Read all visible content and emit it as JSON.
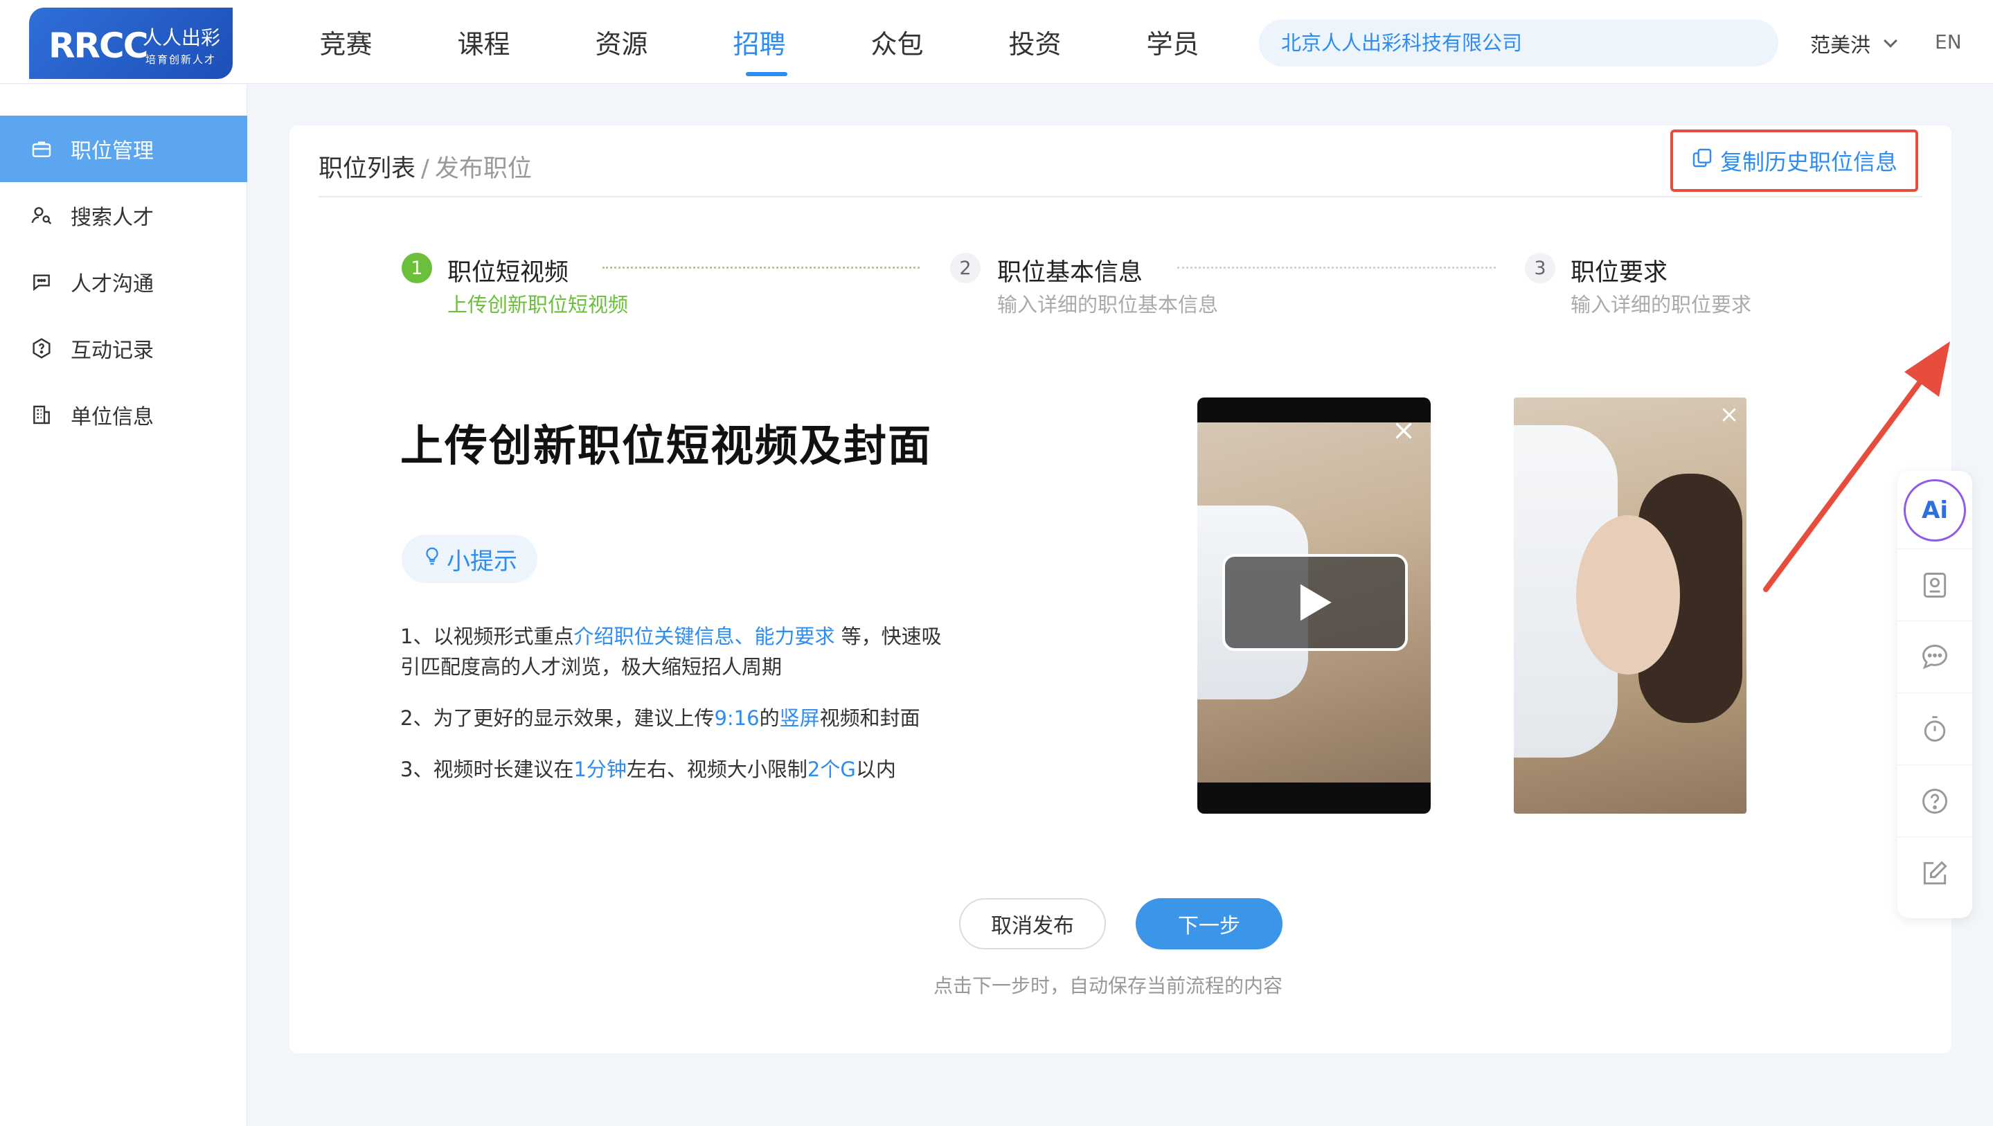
{
  "brand": {
    "logo_text": "RRCC",
    "logo_cn": "人人出彩",
    "logo_sub": "培育创新人才"
  },
  "nav": {
    "items": [
      {
        "label": "竞赛"
      },
      {
        "label": "课程"
      },
      {
        "label": "资源"
      },
      {
        "label": "招聘"
      },
      {
        "label": "众包"
      },
      {
        "label": "投资"
      },
      {
        "label": "学员"
      }
    ],
    "active": "招聘"
  },
  "header": {
    "company": "北京人人出彩科技有限公司",
    "user_name": "范美洪",
    "lang": "EN"
  },
  "sidebar": {
    "items": [
      {
        "label": "职位管理",
        "icon": "briefcase-icon"
      },
      {
        "label": "搜索人才",
        "icon": "person-search-icon"
      },
      {
        "label": "人才沟通",
        "icon": "chat-icon"
      },
      {
        "label": "互动记录",
        "icon": "hexagon-question-icon"
      },
      {
        "label": "单位信息",
        "icon": "building-icon"
      }
    ],
    "active": "职位管理"
  },
  "breadcrumb": {
    "parent": "职位列表",
    "separator": "/",
    "current": "发布职位"
  },
  "copy_history": {
    "label": "复制历史职位信息"
  },
  "steps": [
    {
      "num": "1",
      "title": "职位短视频",
      "desc": "上传创新职位短视频",
      "status": "active"
    },
    {
      "num": "2",
      "title": "职位基本信息",
      "desc": "输入详细的职位基本信息",
      "status": "todo"
    },
    {
      "num": "3",
      "title": "职位要求",
      "desc": "输入详细的职位要求",
      "status": "todo"
    }
  ],
  "content": {
    "title": "上传创新职位短视频及封面",
    "tip_label": "小提示",
    "p1": {
      "a": "1、以视频形式重点",
      "b": "介绍职位关键信息、能力要求",
      "c": " 等，快速吸",
      "d": "引匹配度高的人才浏览，极大缩短招人周期"
    },
    "p2": {
      "a": "2、为了更好的显示效果，建议上传",
      "b": "9:16",
      "c": "的",
      "d": "竖屏",
      "e": "视频和封面"
    },
    "p3": {
      "a": "3、视频时长建议在",
      "b": "1分钟",
      "c": "左右、视频大小限制",
      "d": "2个G",
      "e": "以内"
    }
  },
  "actions": {
    "cancel": "取消发布",
    "next": "下一步",
    "hint": "点击下一步时，自动保存当前流程的内容"
  },
  "toolbar": {
    "ai_label": "Ai",
    "items": [
      "profile-card-icon",
      "message-icon",
      "timer-icon",
      "help-icon",
      "edit-icon"
    ]
  },
  "colors": {
    "primary": "#2d8cf0",
    "success": "#6cbf3a",
    "highlight_border": "#e74c3c",
    "sidebar_active": "#5ba6ee"
  }
}
